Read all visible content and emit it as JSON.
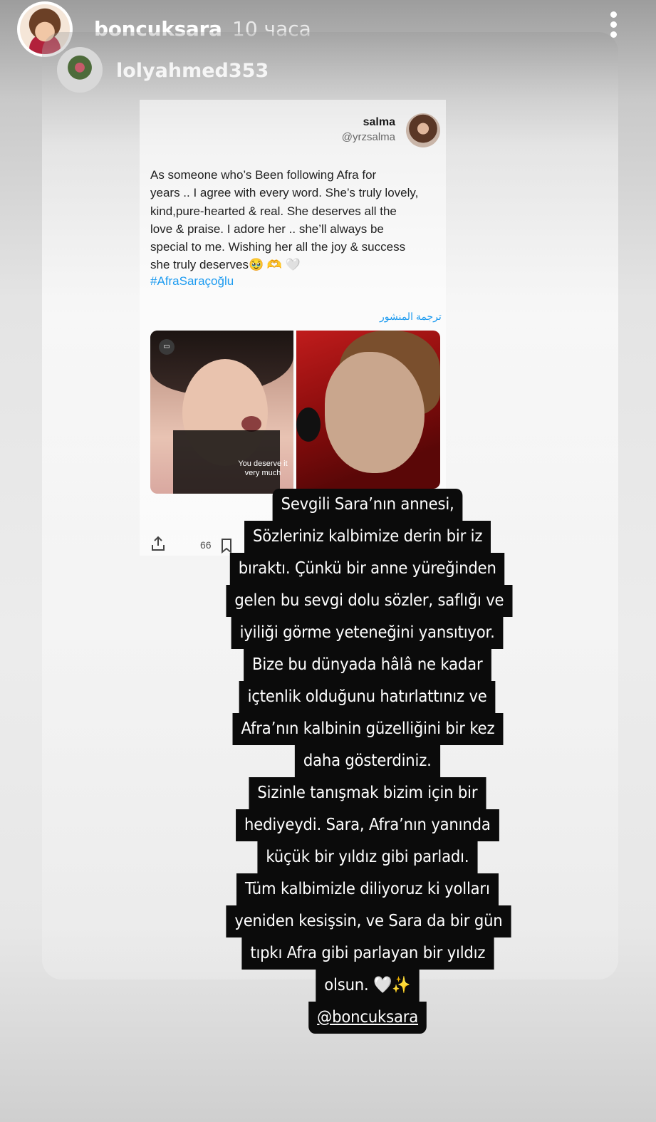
{
  "header": {
    "username": "boncuksara",
    "time_ago": "10 часа"
  },
  "shared_post": {
    "username": "lolyahmed353"
  },
  "tweet": {
    "name": "salma",
    "handle": "@yrzsalma",
    "text_lines": [
      "As someone who’s Been following Afra for",
      "years .. I agree with every word. She’s truly lovely,",
      "kind,pure-hearted & real. She deserves all the",
      "love & praise. I adore her .. she’ll always be",
      "special to me. Wishing her all the joy & success",
      "she truly deserves🥹 🫶 🤍"
    ],
    "hashtag": "#AfraSaraçoğlu",
    "translate_label": "ترجمة المنشور",
    "media_caption": "You deserve it very much",
    "view_count": "66"
  },
  "caption_overlay": {
    "lines": [
      "Sevgili Sara’nın annesi,",
      "Sözleriniz kalbimize derin bir iz",
      "bıraktı. Çünkü bir anne yüreğinden",
      "gelen bu sevgi dolu sözler, saflığı ve",
      "iyiliği görme yeteneğini yansıtıyor.",
      "Bize bu dünyada hâlâ ne kadar",
      "içtenlik olduğunu hatırlattınız ve",
      "Afra’nın kalbinin güzelliğini bir kez",
      "daha gösterdiniz.",
      "Sizinle tanışmak bizim için bir",
      "hediyeydi. Sara, Afra’nın yanında",
      "küçük bir yıldız gibi parladı.",
      "Tüm kalbimizle diliyoruz ki yolları",
      "yeniden kesişsin, ve Sara da bir gün",
      "tıpkı Afra gibi parlayan bir yıldız",
      "olsun. 🤍✨"
    ],
    "mention": "@boncuksara"
  }
}
